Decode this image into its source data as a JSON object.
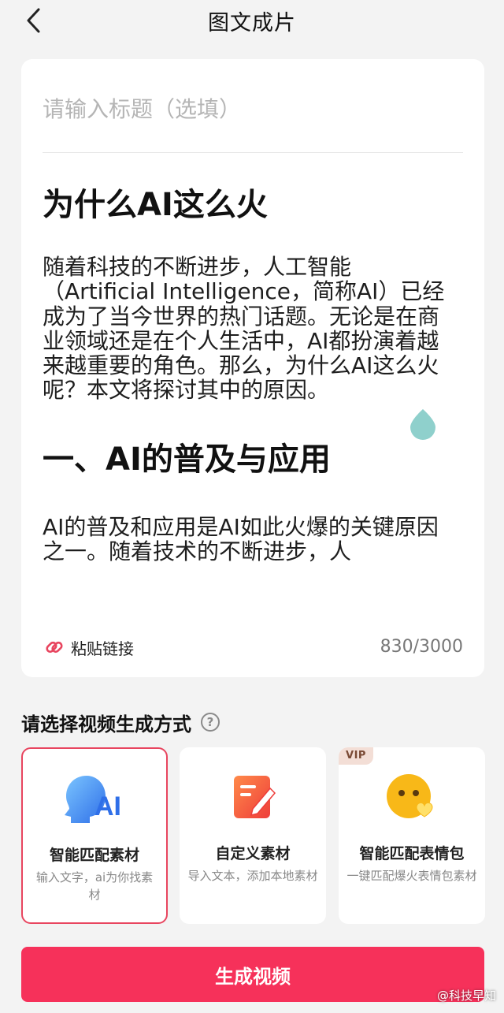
{
  "header": {
    "title": "图文成片"
  },
  "editor": {
    "title_placeholder": "请输入标题（选填）",
    "title_value": "",
    "heading": "为什么AI这么火",
    "paragraph": "随着科技的不断进步，人工智能（Artificial Intelligence，简称AI）已经成为了当今世界的热门话题。无论是在商业领域还是在个人生活中，AI都扮演着越来越重要的角色。那么，为什么AI这么火呢？本文将探讨其中的原因。",
    "subheading": "一、AI的普及与应用",
    "paragraph2": "AI的普及和应用是AI如此火爆的关键原因之一。随着技术的不断进步，人",
    "paste_link_label": "粘贴链接",
    "char_count": "830/3000"
  },
  "section": {
    "title": "请选择视频生成方式",
    "help_icon": "question-circle-icon"
  },
  "options": [
    {
      "title": "智能匹配素材",
      "desc": "输入文字，ai为你找素材",
      "icon": "ai-head-icon",
      "icon_text": "AI",
      "selected": true
    },
    {
      "title": "自定义素材",
      "desc": "导入文本，添加本地素材",
      "icon": "edit-document-icon",
      "selected": false
    },
    {
      "title": "智能匹配表情包",
      "desc": "一键匹配爆火表情包素材",
      "icon": "emoji-heart-icon",
      "badge": "VIP",
      "selected": false
    }
  ],
  "generate_button": {
    "label": "生成视频"
  },
  "watermark": "@科技早知",
  "colors": {
    "accent": "#f6315a",
    "selected_border": "#e8455f",
    "ai_blue": "#3a82f0",
    "edit_orange": "#f25a32",
    "emoji_yellow": "#f8b818"
  }
}
